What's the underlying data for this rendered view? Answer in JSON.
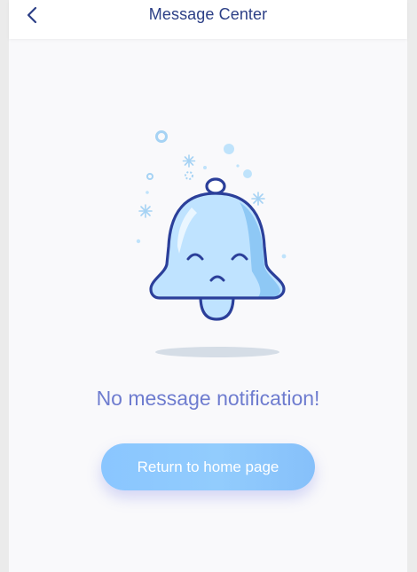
{
  "header": {
    "title": "Message Center",
    "back_icon": "chevron-left-icon"
  },
  "empty_state": {
    "illustration_icon": "bell-icon",
    "message": "No message notification!"
  },
  "actions": {
    "home_label": "Return to home page"
  },
  "colors": {
    "title": "#2c3f86",
    "message": "#6e7ccf",
    "button_bg": "#8ac6ff",
    "button_text": "#ffffff",
    "bell_fill": "#bfe3ff",
    "bell_outline": "#2b3f9a"
  }
}
